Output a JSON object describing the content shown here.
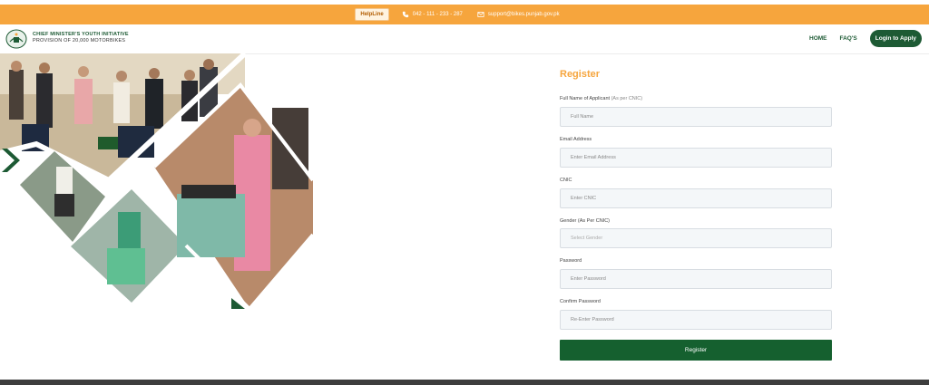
{
  "topbar": {
    "helpline_label": "HelpLine",
    "phone": "042 - 111 - 233 - 287",
    "email": "support@bikes.punjab.gov.pk",
    "phone_icon": "phone-icon",
    "email_icon": "mail-icon"
  },
  "header": {
    "brand_line1": "CHIEF MINISTER'S YOUTH INITIATIVE",
    "brand_line2": "PROVISION OF 20,000 MOTORBIKES",
    "nav": {
      "home": "HOME",
      "faqs": "FAQ'S",
      "apply": "Login to Apply"
    }
  },
  "form": {
    "title": "Register",
    "fields": {
      "full_name": {
        "label": "Full Name of Applicant",
        "label_hint": "(As per CNIC)",
        "placeholder": "Full Name"
      },
      "email": {
        "label": "Email Address",
        "placeholder": "Enter Email Address"
      },
      "cnic": {
        "label": "CNIC",
        "placeholder": "Enter CNIC"
      },
      "gender": {
        "label": "Gender (As Per CNIC)",
        "value": "Select Gender"
      },
      "password": {
        "label": "Password",
        "placeholder": "Enter Password"
      },
      "confirm_password": {
        "label": "Confirm Password",
        "placeholder": "Re-Enter Password"
      }
    },
    "submit_label": "Register"
  },
  "colors": {
    "accent": "#f6a53d",
    "brand_green": "#1d5a34",
    "button_green": "#15602f"
  }
}
